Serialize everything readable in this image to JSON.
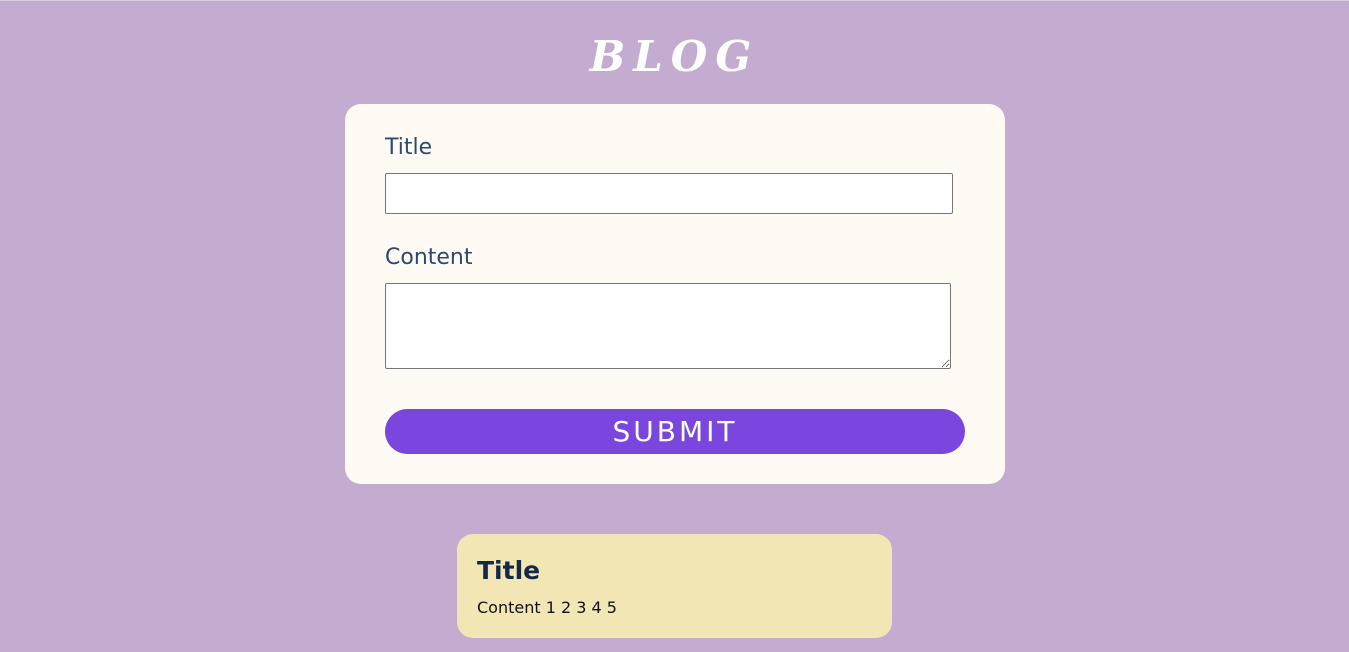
{
  "header": {
    "title": "BLOG"
  },
  "form": {
    "title_label": "Title",
    "title_value": "",
    "content_label": "Content",
    "content_value": "",
    "submit_label": "SUBMIT"
  },
  "posts": [
    {
      "title": "Title",
      "content": "Content 1 2 3 4 5"
    }
  ],
  "colors": {
    "background": "#c4acd1",
    "form_card": "#fffbf4",
    "accent": "#7a46dd",
    "label_text": "#2b4a6f",
    "post_card": "#f3e6b5",
    "post_title_text": "#142847"
  }
}
